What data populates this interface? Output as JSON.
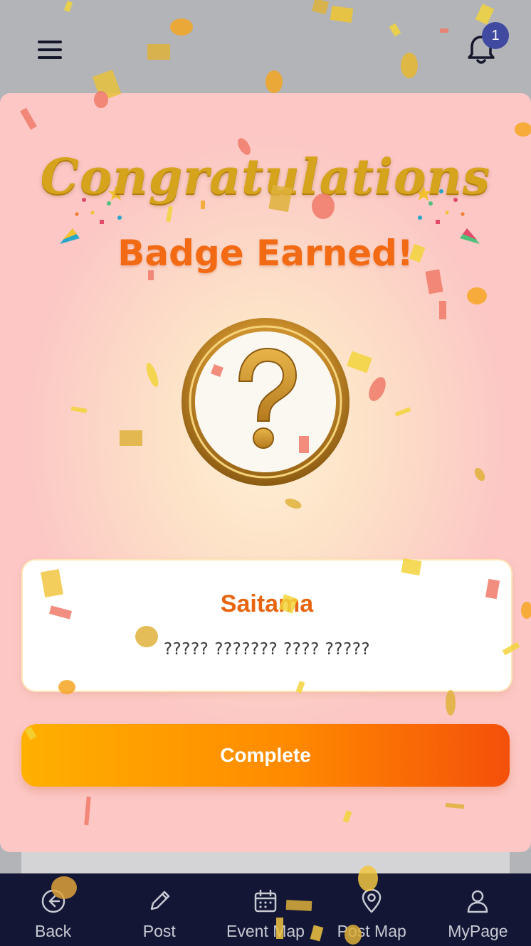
{
  "header": {
    "menu_icon": "hamburger-menu-icon",
    "bell_icon": "bell-icon",
    "notification_count": "1"
  },
  "modal": {
    "congrats_text": "Congratulations",
    "headline": "Badge Earned!",
    "badge_icon": "question-mark-badge-icon",
    "card": {
      "name": "Saitama",
      "description": "????? ??????? ???? ?????"
    },
    "complete_label": "Complete"
  },
  "bottom_nav": {
    "items": [
      {
        "label": "Back",
        "icon": "back-arrow-icon"
      },
      {
        "label": "Post",
        "icon": "pencil-icon"
      },
      {
        "label": "Event Map",
        "icon": "calendar-icon"
      },
      {
        "label": "Post Map",
        "icon": "map-pin-icon"
      },
      {
        "label": "MyPage",
        "icon": "user-icon"
      }
    ]
  },
  "colors": {
    "accent_orange": "#f26a14",
    "gold": "#d6a41c",
    "nav_bg": "#131735",
    "badge_blue": "#3f4aa0"
  }
}
